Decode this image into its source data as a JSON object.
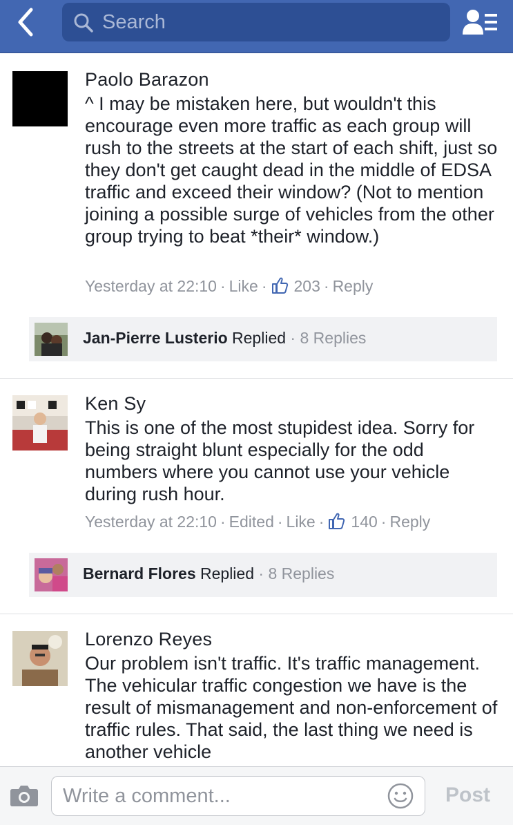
{
  "header": {
    "search_placeholder": "Search"
  },
  "comments": [
    {
      "author": "Paolo Barazon",
      "text": "^ I may be mistaken here, but wouldn't this encourage even more traffic as each group will rush to the streets at the start of each shift, just so they don't get caught dead in the middle of EDSA traffic and exceed their window? (Not to mention joining a possible surge of vehicles from the other group trying to beat *their* window.)",
      "time": "Yesterday at 22:10",
      "like_label": "Like",
      "likes": "203",
      "reply_label": "Reply",
      "replies": {
        "name": "Jan-Pierre Lusterio",
        "replied_label": "Replied",
        "count": "8 Replies"
      }
    },
    {
      "author": "Ken Sy",
      "text": "This is one of the most stupidest idea. Sorry for being straight blunt especially for the odd numbers where you cannot use your vehicle during rush hour.",
      "time": "Yesterday at 22:10",
      "edited_label": "Edited",
      "like_label": "Like",
      "likes": "140",
      "reply_label": "Reply",
      "replies": {
        "name": "Bernard Flores",
        "replied_label": "Replied",
        "count": "8 Replies"
      }
    },
    {
      "author": "Lorenzo Reyes",
      "text": "Our problem isn't traffic. It's traffic management. The vehicular traffic congestion we have is the result of mismanagement and non-enforcement of traffic rules. That said, the last thing we need is another vehicle"
    }
  ],
  "composer": {
    "placeholder": "Write a comment...",
    "post_label": "Post"
  },
  "colors": {
    "header_blue": "#4267b2",
    "meta_gray": "#90949c",
    "like_blue": "#4267b2"
  }
}
